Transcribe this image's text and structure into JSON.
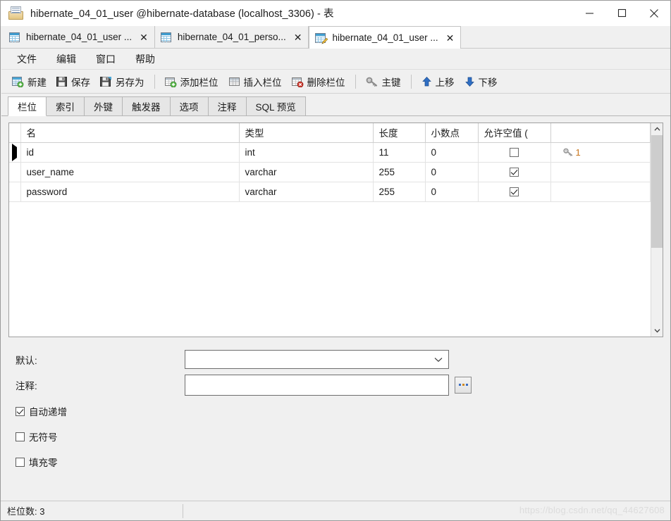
{
  "window": {
    "title": "hibernate_04_01_user @hibernate-database (localhost_3306) - 表",
    "icon": "table-window-icon",
    "minimize_label": "—",
    "maximize_label": "☐",
    "close_label": "✕"
  },
  "document_tabs": [
    {
      "label": "hibernate_04_01_user ...",
      "icon": "table-icon",
      "close": "✕",
      "active": false
    },
    {
      "label": "hibernate_04_01_perso...",
      "icon": "table-icon",
      "close": "✕",
      "active": false
    },
    {
      "label": "hibernate_04_01_user ...",
      "icon": "table-design-icon",
      "close": "✕",
      "active": true
    }
  ],
  "menu": {
    "items": [
      {
        "label": "文件",
        "name": "menu-file"
      },
      {
        "label": "编辑",
        "name": "menu-edit"
      },
      {
        "label": "窗口",
        "name": "menu-window"
      },
      {
        "label": "帮助",
        "name": "menu-help"
      }
    ]
  },
  "toolbar": {
    "groups": [
      [
        {
          "label": "新建",
          "icon": "new-table-icon",
          "name": "toolbar-new"
        },
        {
          "label": "保存",
          "icon": "save-icon",
          "name": "toolbar-save"
        },
        {
          "label": "另存为",
          "icon": "save-as-icon",
          "name": "toolbar-save-as"
        }
      ],
      [
        {
          "label": "添加栏位",
          "icon": "add-field-icon",
          "name": "toolbar-add-field"
        },
        {
          "label": "插入栏位",
          "icon": "insert-field-icon",
          "name": "toolbar-insert-field"
        },
        {
          "label": "删除栏位",
          "icon": "delete-field-icon",
          "name": "toolbar-delete-field"
        }
      ],
      [
        {
          "label": "主键",
          "icon": "key-icon",
          "name": "toolbar-primary-key"
        }
      ],
      [
        {
          "label": "上移",
          "icon": "arrow-up-icon",
          "name": "toolbar-move-up"
        },
        {
          "label": "下移",
          "icon": "arrow-down-icon",
          "name": "toolbar-move-down"
        }
      ]
    ]
  },
  "subtabs": [
    {
      "label": "栏位",
      "name": "tab-fields",
      "active": true
    },
    {
      "label": "索引",
      "name": "tab-indexes",
      "active": false
    },
    {
      "label": "外键",
      "name": "tab-foreign-keys",
      "active": false
    },
    {
      "label": "触发器",
      "name": "tab-triggers",
      "active": false
    },
    {
      "label": "选项",
      "name": "tab-options",
      "active": false
    },
    {
      "label": "注释",
      "name": "tab-comment",
      "active": false
    },
    {
      "label": "SQL 预览",
      "name": "tab-sql-preview",
      "active": false
    }
  ],
  "grid": {
    "columns": [
      "名",
      "类型",
      "长度",
      "小数点",
      "允许空值 ("
    ],
    "rows": [
      {
        "selected": true,
        "name": "id",
        "type": "int",
        "length": "11",
        "decimals": "0",
        "nullable": false,
        "key_icon": "key-icon",
        "key_index": "1"
      },
      {
        "selected": false,
        "name": "user_name",
        "type": "varchar",
        "length": "255",
        "decimals": "0",
        "nullable": true,
        "key_icon": "",
        "key_index": ""
      },
      {
        "selected": false,
        "name": "password",
        "type": "varchar",
        "length": "255",
        "decimals": "0",
        "nullable": true,
        "key_icon": "",
        "key_index": ""
      }
    ]
  },
  "form": {
    "default_label": "默认:",
    "default_value": "",
    "comment_label": "注释:",
    "comment_value": "",
    "browse_button": "...",
    "checkboxes": [
      {
        "label": "自动递增",
        "checked": true,
        "name": "checkbox-auto-increment"
      },
      {
        "label": "无符号",
        "checked": false,
        "name": "checkbox-unsigned"
      },
      {
        "label": "填充零",
        "checked": false,
        "name": "checkbox-zerofill"
      }
    ]
  },
  "statusbar": {
    "field_count": "栏位数: 3",
    "watermark": "https://blog.csdn.net/qq_44627608"
  },
  "colors": {
    "accent_blue": "#3f9dd0",
    "key_orange": "#c8741a",
    "window_bg": "#f0f0f0",
    "grid_bg": "#ffffff"
  }
}
